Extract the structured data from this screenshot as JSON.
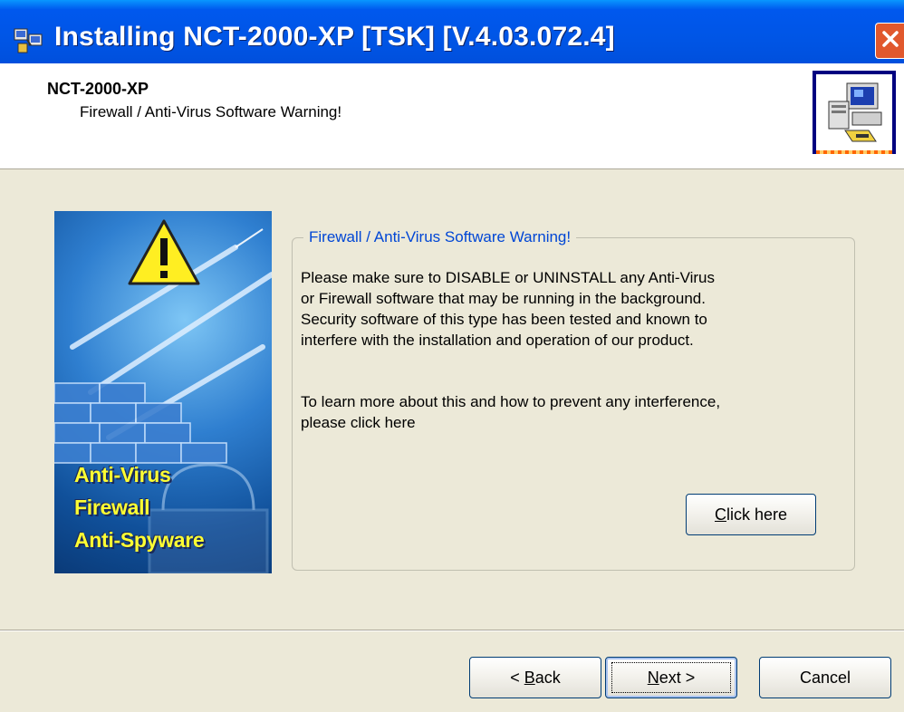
{
  "window": {
    "title": "Installing NCT-2000-XP [TSK] [V.4.03.072.4]"
  },
  "header": {
    "title": "NCT-2000-XP",
    "subtitle": "Firewall / Anti-Virus Software Warning!"
  },
  "banner": {
    "lines": [
      "Anti-Virus",
      "Firewall",
      "Anti-Spyware"
    ]
  },
  "group": {
    "legend": "Firewall / Anti-Virus Software Warning!",
    "paragraph1": [
      "Please make sure to DISABLE or UNINSTALL any Anti-Virus",
      "or Firewall software that may be running in the background.",
      "Security software of this type has been tested and known to",
      "interfere with the installation and operation of our product."
    ],
    "paragraph2": [
      "To learn more about this and how to prevent any interference,",
      "please click here"
    ],
    "click_button": {
      "hotkey": "C",
      "rest": "lick here"
    }
  },
  "footer": {
    "back": {
      "prefix": "< ",
      "hotkey": "B",
      "rest": "ack"
    },
    "next": {
      "hotkey": "N",
      "rest": "ext >"
    },
    "cancel": "Cancel"
  },
  "colors": {
    "titlebar": "#0055e5",
    "dialog_bg": "#ece9d8",
    "legend_text": "#0046d5",
    "close_button": "#e1582d",
    "banner_text": "#ffff33"
  }
}
